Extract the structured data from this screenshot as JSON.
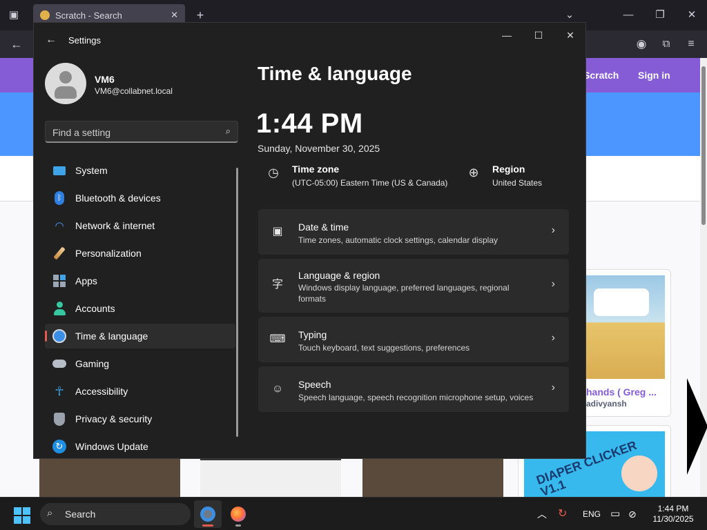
{
  "browser": {
    "tab_title": "Scratch - Search",
    "header_links": [
      "Scratch",
      "Sign in"
    ],
    "card_title": "hands ( Greg ...",
    "card_author": "adivyansh",
    "thumb_text": "DIAPER CLICKER V1.1"
  },
  "settings": {
    "window_title": "Settings",
    "user": {
      "name": "VM6",
      "email": "VM6@collabnet.local"
    },
    "search_placeholder": "Find a setting",
    "nav": [
      {
        "label": "System",
        "icon": "system-icon"
      },
      {
        "label": "Bluetooth & devices",
        "icon": "bluetooth-icon"
      },
      {
        "label": "Network & internet",
        "icon": "wifi-icon"
      },
      {
        "label": "Personalization",
        "icon": "brush-icon"
      },
      {
        "label": "Apps",
        "icon": "apps-icon"
      },
      {
        "label": "Accounts",
        "icon": "accounts-icon"
      },
      {
        "label": "Time & language",
        "icon": "time-language-icon",
        "active": true
      },
      {
        "label": "Gaming",
        "icon": "gamepad-icon"
      },
      {
        "label": "Accessibility",
        "icon": "accessibility-icon"
      },
      {
        "label": "Privacy & security",
        "icon": "shield-icon"
      },
      {
        "label": "Windows Update",
        "icon": "update-icon"
      }
    ],
    "page_title": "Time & language",
    "time": "1:44 PM",
    "date": "Sunday, November 30, 2025",
    "timezone": {
      "label": "Time zone",
      "value": "(UTC-05:00) Eastern Time (US & Canada)"
    },
    "region": {
      "label": "Region",
      "value": "United States"
    },
    "cards": [
      {
        "title": "Date & time",
        "subtitle": "Time zones, automatic clock settings, calendar display",
        "icon": "calendar-clock-icon"
      },
      {
        "title": "Language & region",
        "subtitle": "Windows display language, preferred languages, regional formats",
        "icon": "language-icon"
      },
      {
        "title": "Typing",
        "subtitle": "Touch keyboard, text suggestions, preferences",
        "icon": "keyboard-icon"
      },
      {
        "title": "Speech",
        "subtitle": "Speech language, speech recognition microphone setup, voices",
        "icon": "speech-icon"
      }
    ]
  },
  "taskbar": {
    "search_label": "Search",
    "lang": "ENG",
    "time": "1:44 PM",
    "date": "11/30/2025"
  },
  "colors": {
    "accent": "#4cc2ff",
    "scratch_purple": "#855cd6",
    "active_indicator": "#e35b4f"
  }
}
